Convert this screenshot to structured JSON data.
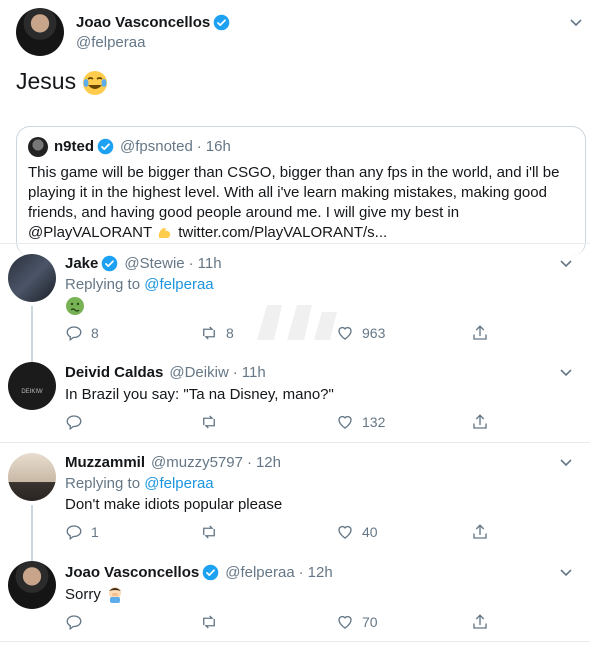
{
  "main_tweet": {
    "name": "Joao Vasconcellos",
    "handle": "@felperaa",
    "text": "Jesus",
    "quote": {
      "name": "n9ted",
      "handle": "@fpsnoted",
      "time": "16h",
      "line1": "This game will be bigger than CSGO, bigger than any fps in the world, and i'll be",
      "line2": "playing it in the highest level. With all i've learn making mistakes, making good",
      "line3": "friends, and having good people around me. I will give my best in",
      "mention": "@PlayVALORANT",
      "url": "twitter.com/PlayVALORANT/s..."
    }
  },
  "replies": [
    {
      "name": "Jake",
      "handle": "@Stewie",
      "time": "11h",
      "replying_prefix": "Replying to",
      "replying_to": "@felperaa",
      "text": "",
      "replies": "8",
      "retweets": "8",
      "likes": "963"
    },
    {
      "name": "Deivid Caldas",
      "handle": "@Deikiw",
      "time": "11h",
      "text": "In Brazil you say: \"Ta na Disney, mano?\"",
      "replies": "",
      "retweets": "",
      "likes": "132",
      "avatar_text": "DEIKIW"
    },
    {
      "name": "Muzzammil",
      "handle": "@muzzy5797",
      "time": "12h",
      "replying_prefix": "Replying to",
      "replying_to": "@felperaa",
      "text": "Don't make idiots popular please",
      "replies": "1",
      "retweets": "",
      "likes": "40"
    },
    {
      "name": "Joao Vasconcellos",
      "handle": "@felperaa",
      "time": "12h",
      "text": "Sorry",
      "replies": "",
      "retweets": "",
      "likes": "70"
    }
  ],
  "colors": {
    "link": "#1b95e0",
    "secondary": "#657786",
    "verified": "#1da1f2",
    "border": "#e6ecf0"
  },
  "icons": [
    "verified-badge-icon",
    "chevron-down-icon",
    "reply-icon",
    "retweet-icon",
    "like-icon",
    "share-icon",
    "joy-emoji",
    "nauseated-emoji",
    "flexed-biceps-emoji",
    "man-facepalming-emoji"
  ]
}
